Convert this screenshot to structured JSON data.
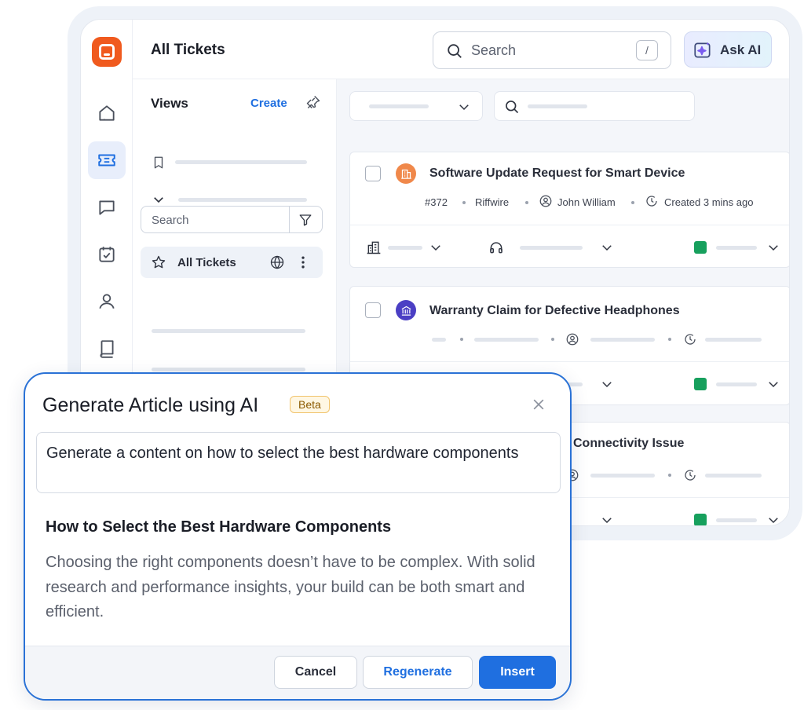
{
  "header": {
    "title": "All Tickets",
    "search_placeholder": "Search",
    "search_shortcut": "/",
    "ask_ai_label": "Ask AI"
  },
  "views": {
    "title": "Views",
    "create_label": "Create",
    "search_placeholder": "Search",
    "active_item": "All Tickets"
  },
  "tickets": [
    {
      "title": "Software Update Request for Smart Device",
      "id": "#372",
      "company": "Riffwire",
      "assignee": "John William",
      "created": "Created 3 mins ago",
      "status_color": "#17a05d",
      "avatar_color": "#f0884a"
    },
    {
      "title": "Warranty Claim for Defective Headphones",
      "status_color": "#17a05d",
      "avatar_color": "#4b3fc4"
    },
    {
      "title": "Connectivity Issue",
      "status_color": "#17a05d"
    }
  ],
  "modal": {
    "title": "Generate Article using AI",
    "badge": "Beta",
    "prompt": "Generate a content on how to select the best hardware components",
    "result_title": "How to Select the Best Hardware Components",
    "result_body": "Choosing the right components doesn’t have to be complex. With solid research and performance insights, your build can be both smart and efficient.",
    "cancel_label": "Cancel",
    "regenerate_label": "Regenerate",
    "insert_label": "Insert"
  },
  "colors": {
    "accent": "#1f6fe0",
    "brand": "#f05a1e",
    "status_green": "#17a05d"
  }
}
